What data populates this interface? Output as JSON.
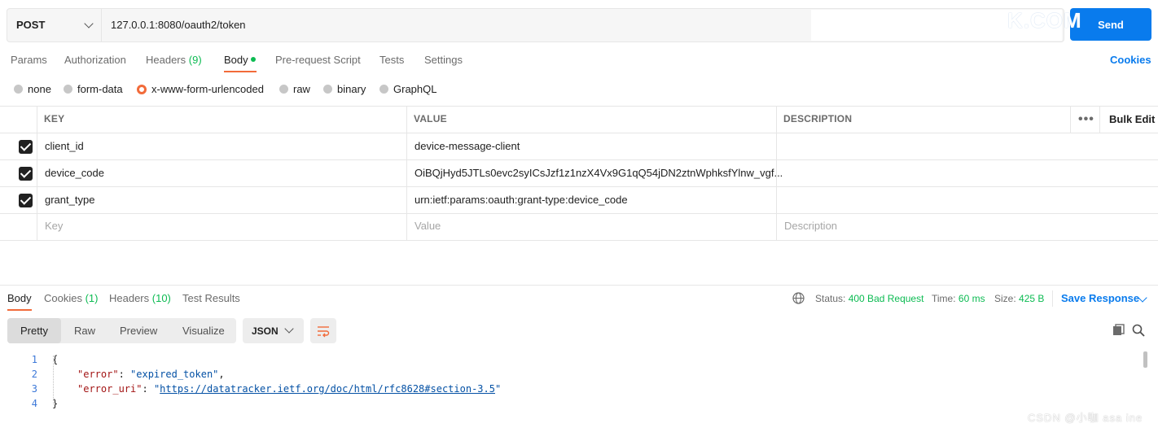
{
  "request": {
    "method": "POST",
    "url": "127.0.0.1:8080/oauth2/token",
    "send_label": "Send",
    "watermark_top": "K.COM"
  },
  "request_tabs": [
    {
      "label": "Params"
    },
    {
      "label": "Authorization"
    },
    {
      "label": "Headers",
      "count": "(9)"
    },
    {
      "label": "Body"
    },
    {
      "label": "Pre-request Script"
    },
    {
      "label": "Tests"
    },
    {
      "label": "Settings"
    }
  ],
  "cookies_label": "Cookies",
  "body_types": [
    "none",
    "form-data",
    "x-www-form-urlencoded",
    "raw",
    "binary",
    "GraphQL"
  ],
  "body_type_selected": "x-www-form-urlencoded",
  "params_table": {
    "headers": {
      "key": "KEY",
      "value": "VALUE",
      "description": "DESCRIPTION",
      "more": "•••",
      "bulk_edit": "Bulk Edit"
    },
    "rows": [
      {
        "checked": true,
        "key": "client_id",
        "value": "device-message-client",
        "description": ""
      },
      {
        "checked": true,
        "key": "device_code",
        "value": "OiBQjHyd5JTLs0evc2syICsJzf1z1nzX4Vx9G1qQ54jDN2ztnWphksfYlnw_vgf...",
        "description": ""
      },
      {
        "checked": true,
        "key": "grant_type",
        "value": "urn:ietf:params:oauth:grant-type:device_code",
        "description": ""
      }
    ],
    "placeholders": {
      "key": "Key",
      "value": "Value",
      "description": "Description"
    }
  },
  "response": {
    "tabs": [
      {
        "label": "Body"
      },
      {
        "label": "Cookies",
        "count": "(1)"
      },
      {
        "label": "Headers",
        "count": "(10)"
      },
      {
        "label": "Test Results"
      }
    ],
    "status_label": "Status:",
    "status_value": "400 Bad Request",
    "time_label": "Time:",
    "time_value": "60 ms",
    "size_label": "Size:",
    "size_value": "425 B",
    "save_response": "Save Response",
    "view_modes": [
      "Pretty",
      "Raw",
      "Preview",
      "Visualize"
    ],
    "view_mode_selected": "Pretty",
    "format": "JSON",
    "code_lines": [
      {
        "n": "1",
        "text": "{"
      },
      {
        "n": "2",
        "key": "\"error\"",
        "sep": ": ",
        "val": "\"expired_token\"",
        "tail": ","
      },
      {
        "n": "3",
        "key": "\"error_uri\"",
        "sep": ": ",
        "q1": "\"",
        "link": "https://datatracker.ietf.org/doc/html/rfc8628#section-3.5",
        "q2": "\""
      },
      {
        "n": "4",
        "text": "}"
      }
    ]
  },
  "watermark_bottom": "CSDN @小咖 asa ine",
  "icons": {
    "globe": "globe-icon",
    "copy": "copy-icon",
    "search": "search-icon",
    "wrap": "wrap-lines-icon",
    "chevron": "chevron-down-icon"
  },
  "colors": {
    "accent": "#f26b3a",
    "primary": "#097bed",
    "success": "#0cbb52"
  }
}
